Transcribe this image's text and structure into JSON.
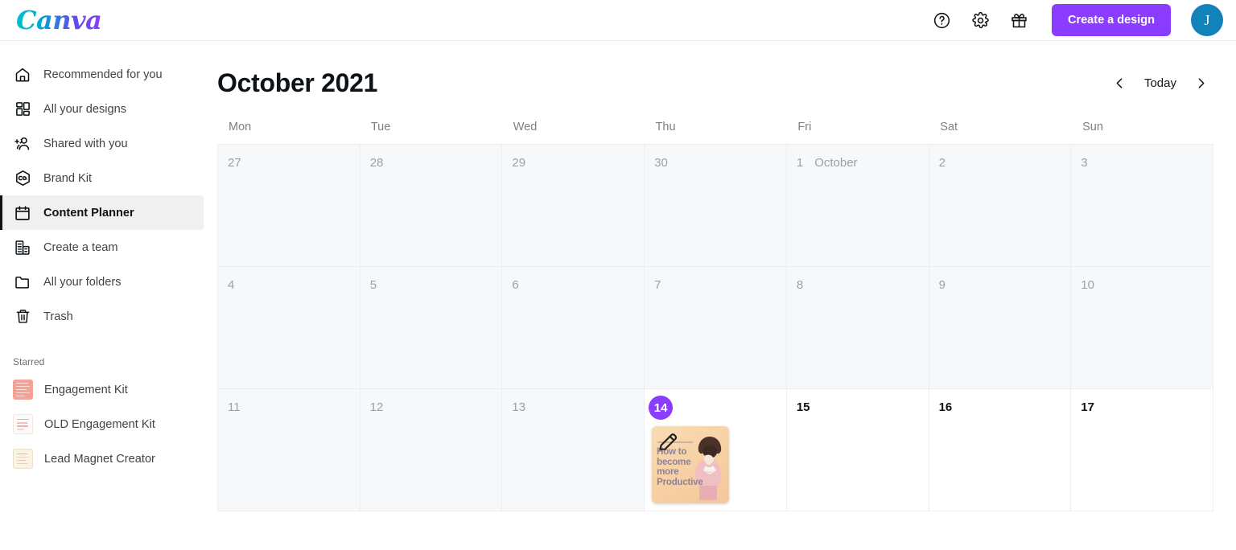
{
  "brand": {
    "logo_text": "Canva",
    "accent_purple": "#8b3dff",
    "avatar_color": "#1283ba"
  },
  "topbar": {
    "help_icon": "help-circle-icon",
    "settings_icon": "gear-icon",
    "gift_icon": "gift-icon",
    "create_label": "Create a design",
    "avatar_initial": "J"
  },
  "sidebar": {
    "items": [
      {
        "label": "Recommended for you",
        "icon": "home-icon",
        "active": false
      },
      {
        "label": "All your designs",
        "icon": "grid-icon",
        "active": false
      },
      {
        "label": "Shared with you",
        "icon": "shared-people-icon",
        "active": false
      },
      {
        "label": "Brand Kit",
        "icon": "brand-hexagon-icon",
        "active": false
      },
      {
        "label": "Content Planner",
        "icon": "calendar-icon",
        "active": true
      },
      {
        "label": "Create a team",
        "icon": "building-icon",
        "active": false
      },
      {
        "label": "All your folders",
        "icon": "folder-icon",
        "active": false
      },
      {
        "label": "Trash",
        "icon": "trash-icon",
        "active": false
      }
    ],
    "starred_label": "Starred",
    "starred": [
      {
        "label": "Engagement Kit",
        "thumb": "#f5a196"
      },
      {
        "label": "OLD Engagement Kit",
        "thumb": "#fdfcfc"
      },
      {
        "label": "Lead Magnet Creator",
        "thumb": "#f7efe2"
      }
    ]
  },
  "main": {
    "title": "October 2021",
    "today_label": "Today",
    "prev_icon": "chevron-left-icon",
    "next_icon": "chevron-right-icon",
    "weekdays": [
      "Mon",
      "Tue",
      "Wed",
      "Thu",
      "Fri",
      "Sat",
      "Sun"
    ],
    "days": [
      {
        "num": "27",
        "past": true
      },
      {
        "num": "28",
        "past": true
      },
      {
        "num": "29",
        "past": true
      },
      {
        "num": "30",
        "past": true
      },
      {
        "num": "1",
        "past": true,
        "month_tag": "October"
      },
      {
        "num": "2",
        "past": true
      },
      {
        "num": "3",
        "past": true
      },
      {
        "num": "4",
        "past": true
      },
      {
        "num": "5",
        "past": true
      },
      {
        "num": "6",
        "past": true
      },
      {
        "num": "7",
        "past": true
      },
      {
        "num": "8",
        "past": true
      },
      {
        "num": "9",
        "past": true
      },
      {
        "num": "10",
        "past": true
      },
      {
        "num": "11",
        "past": true
      },
      {
        "num": "12",
        "past": true
      },
      {
        "num": "13",
        "past": true
      },
      {
        "num": "14",
        "past": false,
        "today": true,
        "design": {
          "title_lines": [
            "How to",
            "become",
            "more",
            "Productive"
          ],
          "edit_icon": "pencil-icon"
        }
      },
      {
        "num": "15",
        "past": false
      },
      {
        "num": "16",
        "past": false
      },
      {
        "num": "17",
        "past": false
      }
    ]
  }
}
